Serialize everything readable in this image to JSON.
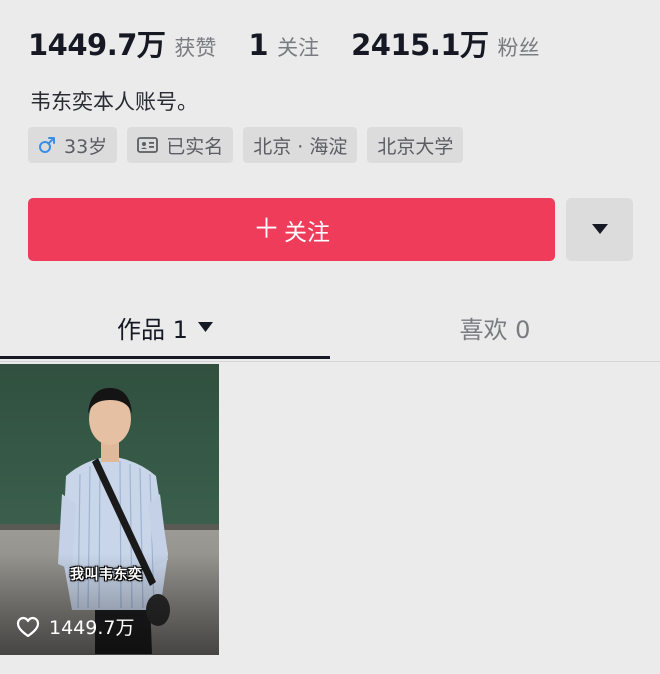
{
  "stats": {
    "likes_count": "1449.7万",
    "likes_label": "获赞",
    "following_count": "1",
    "following_label": "关注",
    "followers_count": "2415.1万",
    "followers_label": "粉丝"
  },
  "bio": "韦东奕本人账号。",
  "tags": {
    "age": "33岁",
    "verified": "已实名",
    "location": "北京 · 海淀",
    "school": "北京大学"
  },
  "actions": {
    "follow_plus": "＋",
    "follow_label": "关注",
    "more_icon": "caret-down-icon"
  },
  "tabs": {
    "works_label": "作品 1",
    "likes_label": "喜欢 0"
  },
  "video": {
    "caption": "我叫韦东奕",
    "like_count": "1449.7万"
  },
  "colors": {
    "accent": "#ee3c5a",
    "background": "#ebebeb",
    "male_icon": "#3a8ee6"
  }
}
